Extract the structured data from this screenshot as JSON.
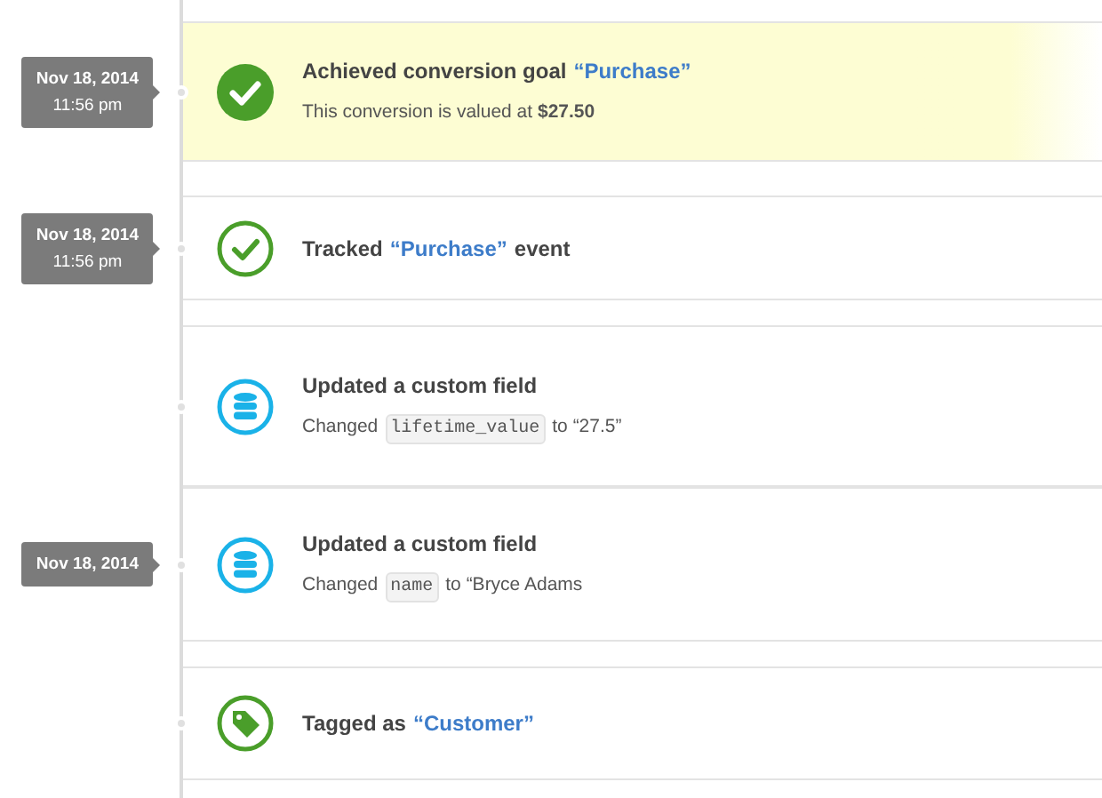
{
  "events": [
    {
      "kind": "goal",
      "highlighted": true,
      "date": "Nov 18, 2014",
      "time": "11:56 pm",
      "title": "Achieved conversion goal",
      "quoted": "“Purchase”",
      "detail": "This conversion is valued at **$27.50**"
    },
    {
      "kind": "tracked",
      "highlighted": false,
      "date": "Nov 18, 2014",
      "time": "11:56 pm",
      "title": "Tracked",
      "quoted": "“Purchase”",
      "title_after": "event"
    },
    {
      "kind": "field",
      "highlighted": false,
      "title": "Updated a custom field",
      "detail_prefix": "Changed",
      "code": "lifetime_value",
      "detail_suffix": "to “27.5”"
    },
    {
      "kind": "field",
      "highlighted": false,
      "date": "Nov 18, 2014",
      "title": "Updated a custom field",
      "detail_prefix": "Changed",
      "code": "name",
      "detail_suffix": "to “Bryce Adams"
    },
    {
      "kind": "tag",
      "highlighted": false,
      "title": "Tagged as",
      "quoted": "“Customer”"
    }
  ]
}
